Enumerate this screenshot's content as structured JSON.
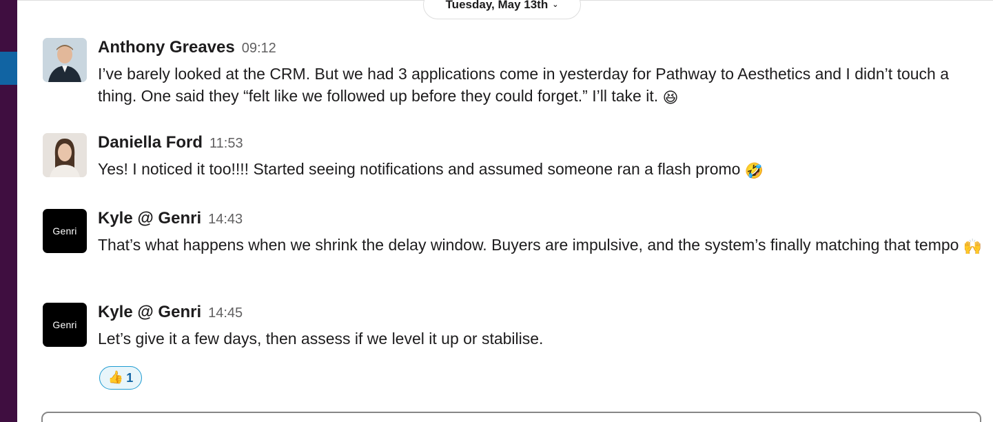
{
  "date_divider": {
    "label": "Tuesday, May 13th",
    "chevron": "⌄"
  },
  "messages": [
    {
      "author": "Anthony Greaves",
      "time": "09:12",
      "avatar": "photo",
      "text": "I’ve barely looked at the CRM.  But we had 3 applications come in yesterday for Pathway to Aesthetics and I didn’t touch a thing. One said they “felt like we followed up before they could forget.”  I’ll take it.",
      "emoji": "😆"
    },
    {
      "author": "Daniella Ford",
      "time": "11:53",
      "avatar": "photo",
      "text": "Yes! I noticed it too!!!! Started seeing notifications and assumed someone ran a flash promo",
      "emoji": "🤣"
    },
    {
      "author": "Kyle @ Genri",
      "time": "14:43",
      "avatar_text": "Genri",
      "text": "That’s what happens when we shrink the delay window. Buyers are impulsive, and the system’s finally matching that tempo",
      "emoji": "🙌"
    },
    {
      "author": "Kyle @ Genri",
      "time": "14:45",
      "avatar_text": "Genri",
      "text": "Let’s give it a few days, then assess if we level it up or stabilise.",
      "emoji": ""
    }
  ],
  "reaction": {
    "emoji": "👍",
    "count": "1"
  },
  "colors": {
    "sidebar": "#3f0e40",
    "sidebar_active": "#1164a3",
    "reaction_border": "#1d9bd1",
    "reaction_text": "#1264a3"
  }
}
